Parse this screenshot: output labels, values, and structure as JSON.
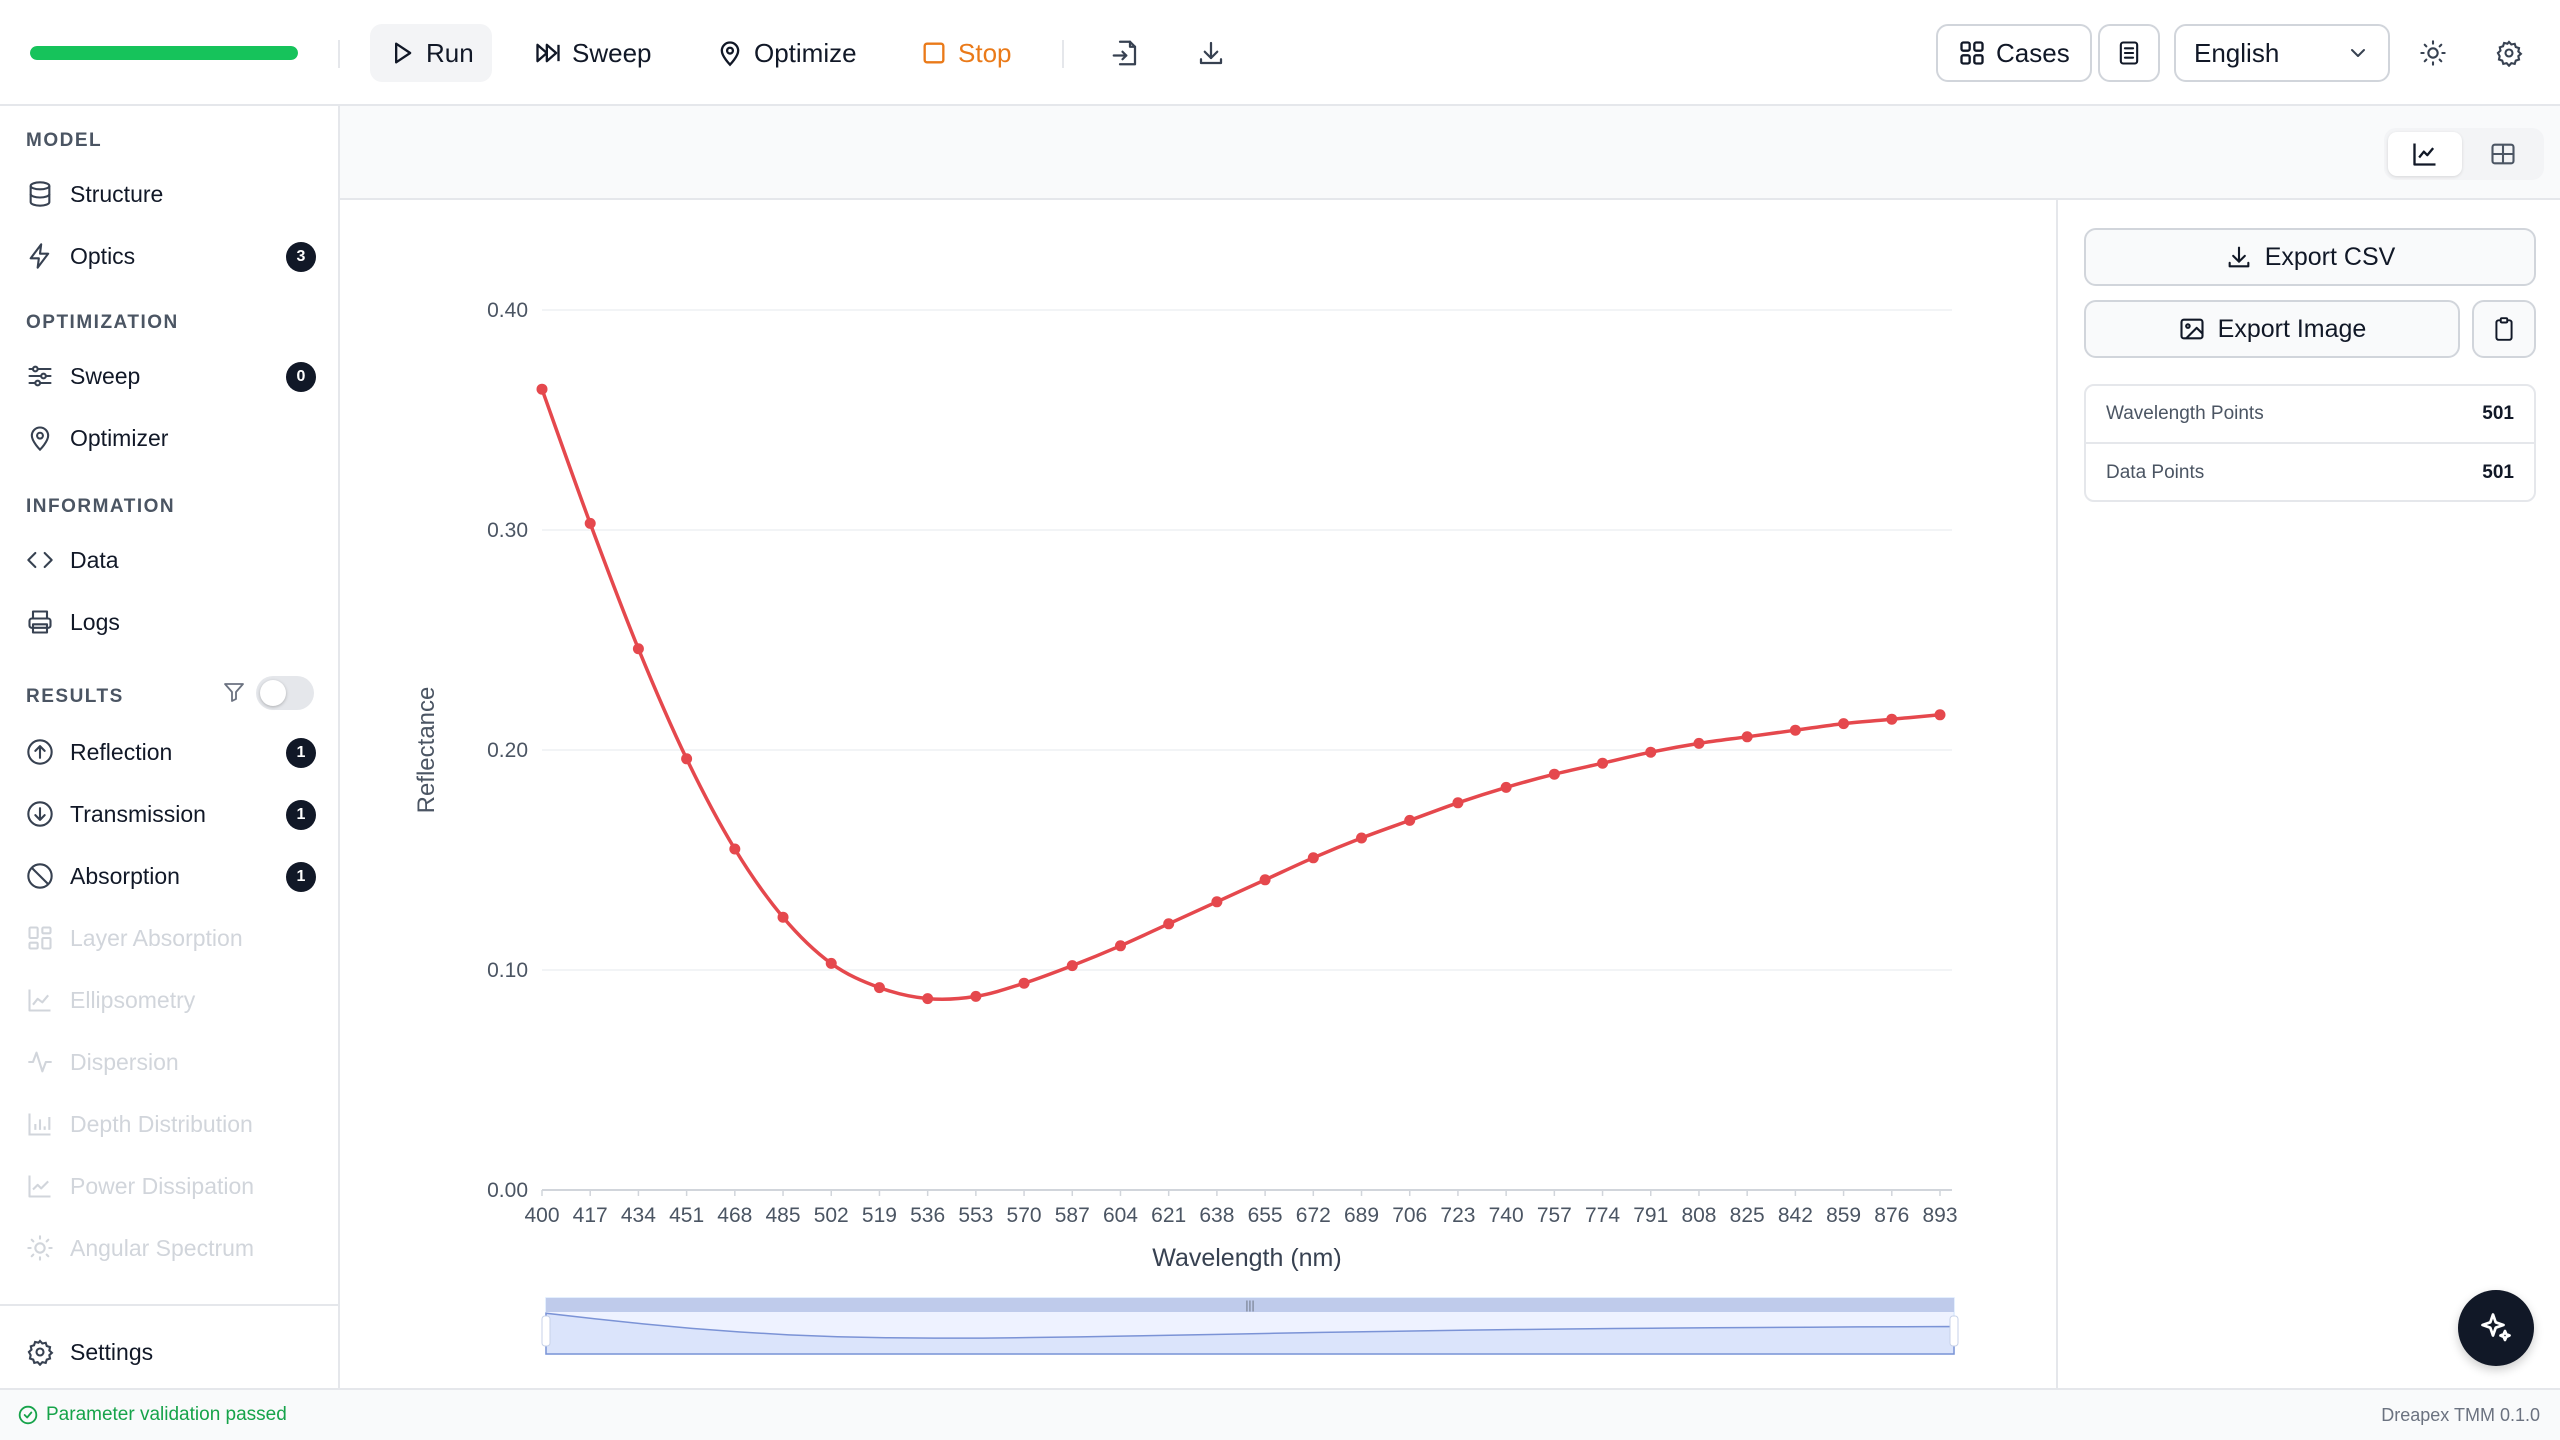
{
  "toolbar": {
    "progress_fraction": 1.0,
    "progress_color": "#16c35b",
    "run_label": "Run",
    "sweep_label": "Sweep",
    "optimize_label": "Optimize",
    "stop_label": "Stop",
    "cases_label": "Cases",
    "language": "English"
  },
  "sidebar": {
    "model_title": "MODEL",
    "structure": "Structure",
    "optics": "Optics",
    "optics_count": "3",
    "optimization_title": "OPTIMIZATION",
    "sweep": "Sweep",
    "sweep_count": "0",
    "optimizer": "Optimizer",
    "information_title": "INFORMATION",
    "data": "Data",
    "logs": "Logs",
    "results_title": "RESULTS",
    "reflection": "Reflection",
    "reflection_count": "1",
    "transmission": "Transmission",
    "transmission_count": "1",
    "absorption": "Absorption",
    "absorption_count": "1",
    "layer_absorption": "Layer Absorption",
    "ellipsometry": "Ellipsometry",
    "dispersion": "Dispersion",
    "depth_distribution": "Depth Distribution",
    "power_dissipation": "Power Dissipation",
    "angular_spectrum": "Angular Spectrum",
    "settings": "Settings"
  },
  "panel": {
    "export_csv": "Export CSV",
    "export_image": "Export Image",
    "wavelength_points_label": "Wavelength Points",
    "wavelength_points_value": "501",
    "data_points_label": "Data Points",
    "data_points_value": "501"
  },
  "status": {
    "message": "Parameter validation passed",
    "version": "Dreapex TMM 0.1.0"
  },
  "chart_data": {
    "type": "line",
    "xlabel": "Wavelength (nm)",
    "ylabel": "Reflectance",
    "ylim": [
      0,
      0.4
    ],
    "yticks": [
      "0.00",
      "0.10",
      "0.20",
      "0.30",
      "0.40"
    ],
    "grid": true,
    "line_color": "#e5484d",
    "x": [
      400,
      417,
      434,
      451,
      468,
      485,
      502,
      519,
      536,
      553,
      570,
      587,
      604,
      621,
      638,
      655,
      672,
      689,
      706,
      723,
      740,
      757,
      774,
      791,
      808,
      825,
      842,
      859,
      876,
      893
    ],
    "series": [
      {
        "values": [
          0.364,
          0.303,
          0.246,
          0.196,
          0.155,
          0.124,
          0.103,
          0.092,
          0.087,
          0.088,
          0.094,
          0.102,
          0.111,
          0.121,
          0.131,
          0.141,
          0.151,
          0.16,
          0.168,
          0.176,
          0.183,
          0.189,
          0.194,
          0.199,
          0.203,
          0.206,
          0.209,
          0.212,
          0.214,
          0.216
        ]
      }
    ]
  }
}
